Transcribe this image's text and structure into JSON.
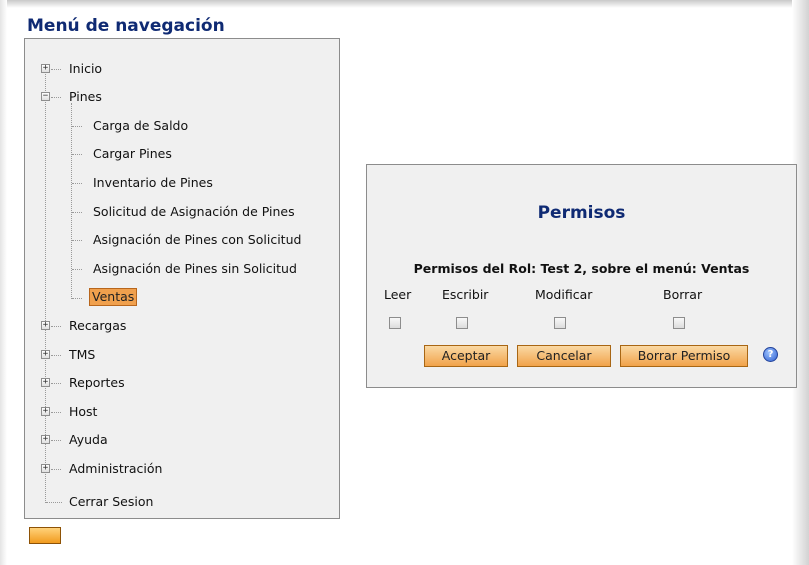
{
  "nav": {
    "title": "Menú de navegación",
    "items": [
      {
        "label": "Inicio",
        "toggle": "+"
      },
      {
        "label": "Pines",
        "toggle": "−",
        "children": [
          "Carga de Saldo",
          "Cargar Pines",
          "Inventario de Pines",
          "Solicitud de Asignación de Pines",
          "Asignación de Pines con Solicitud",
          "Asignación de Pines sin Solicitud",
          "Ventas"
        ]
      },
      {
        "label": "Recargas",
        "toggle": "+"
      },
      {
        "label": "TMS",
        "toggle": "+"
      },
      {
        "label": "Reportes",
        "toggle": "+"
      },
      {
        "label": "Host",
        "toggle": "+"
      },
      {
        "label": "Ayuda",
        "toggle": "+"
      },
      {
        "label": "Administración",
        "toggle": "+"
      },
      {
        "label": "Cerrar Sesion"
      }
    ],
    "selected": "Ventas"
  },
  "permisos": {
    "title": "Permisos",
    "subtitle": "Permisos del Rol: Test 2, sobre el menú: Ventas",
    "columns": [
      "Leer",
      "Escribir",
      "Modificar",
      "Borrar"
    ],
    "checked": [
      false,
      false,
      false,
      false
    ],
    "buttons": {
      "accept": "Aceptar",
      "cancel": "Cancelar",
      "delete": "Borrar Permiso"
    },
    "help_icon": "?"
  },
  "colors": {
    "title_blue": "#0f2a73",
    "selected_orange": "#f0a04d",
    "button_orange": "#f1a24a"
  }
}
